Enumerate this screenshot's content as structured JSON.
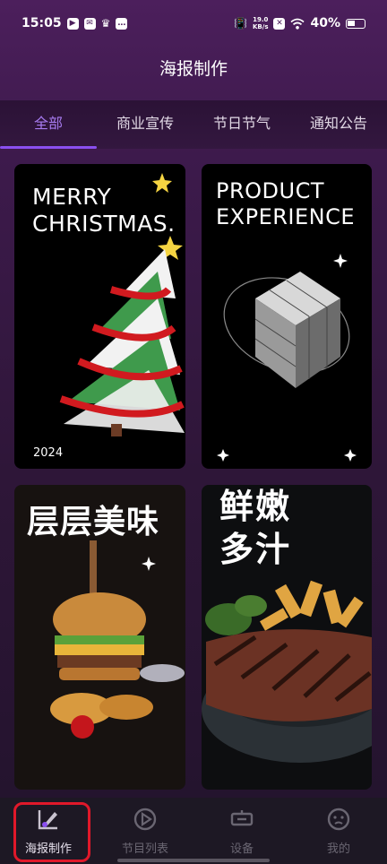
{
  "status_bar": {
    "time": "15:05",
    "net_speed_value": "19.0",
    "net_speed_unit": "KB/s",
    "battery": "40%"
  },
  "header": {
    "title": "海报制作"
  },
  "tabs": [
    {
      "label": "全部",
      "active": true
    },
    {
      "label": "商业宣传",
      "active": false
    },
    {
      "label": "节日节气",
      "active": false
    },
    {
      "label": "通知公告",
      "active": false
    }
  ],
  "posters": [
    {
      "line1": "MERRY",
      "line2": "CHRISTMAS.",
      "caption": "2024"
    },
    {
      "line1": "PRODUCT",
      "line2": "EXPERIENCE"
    },
    {
      "line1": "层层美味"
    },
    {
      "line1": "鲜嫩",
      "line2": "多汁"
    }
  ],
  "bottom_nav": [
    {
      "label": "海报制作",
      "icon": "poster-edit-icon",
      "active": true
    },
    {
      "label": "节目列表",
      "icon": "play-circle-icon",
      "active": false
    },
    {
      "label": "设备",
      "icon": "device-icon",
      "active": false
    },
    {
      "label": "我的",
      "icon": "profile-face-icon",
      "active": false
    }
  ],
  "colors": {
    "accent": "#8a4ff0",
    "active_tab_text": "#a77bf0",
    "highlight": "#e0182a"
  }
}
